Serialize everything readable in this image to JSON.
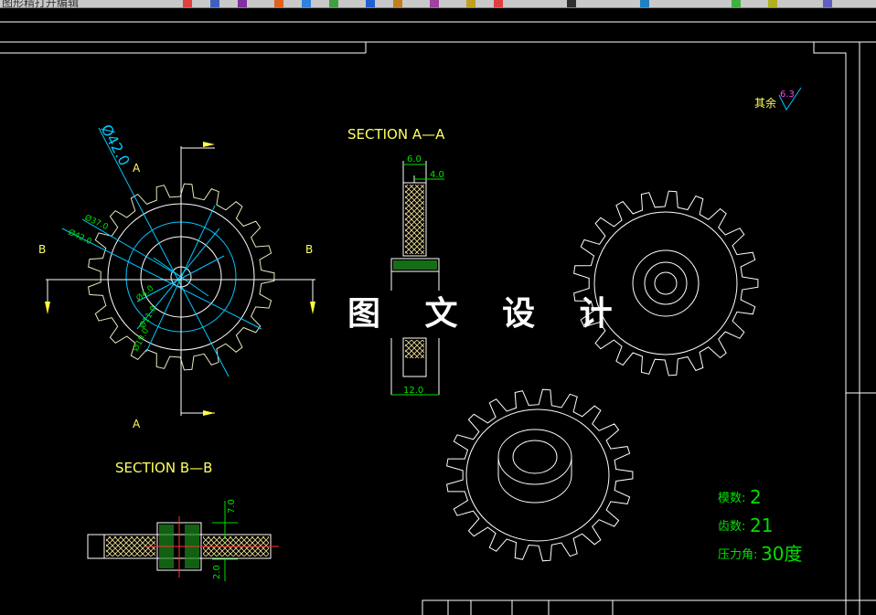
{
  "window": {
    "toolbar_text": "图形精打开编辑"
  },
  "drawing": {
    "section_aa": "SECTION A—A",
    "section_bb": "SECTION B—B",
    "label_a": "A",
    "label_b": "B",
    "watermark": "图 文 设 计",
    "surface_note": "其余",
    "surface_value": "6.3",
    "dims": {
      "d42_big": "Ø42.0",
      "d37": "Ø37.0",
      "d42_small": "Ø42.0",
      "d4": "Ø4.0",
      "d11": "Ø11.0",
      "d19": "Ø19.0",
      "w6": "6.0",
      "w4": "4.0",
      "w12": "12.0",
      "h7": "7.0",
      "h2": "2.0"
    },
    "specs": [
      {
        "label": "模数:",
        "value": "2"
      },
      {
        "label": "齿数:",
        "value": "21"
      },
      {
        "label": "压力角:",
        "value": "30度"
      }
    ]
  },
  "colors": {
    "background": "#000000",
    "frame": "#ffffff",
    "dimension": "#00e000",
    "leader": "#00c8ff",
    "centerline": "#ff3030",
    "label": "#ffff60",
    "hatch": "#e8d890"
  }
}
